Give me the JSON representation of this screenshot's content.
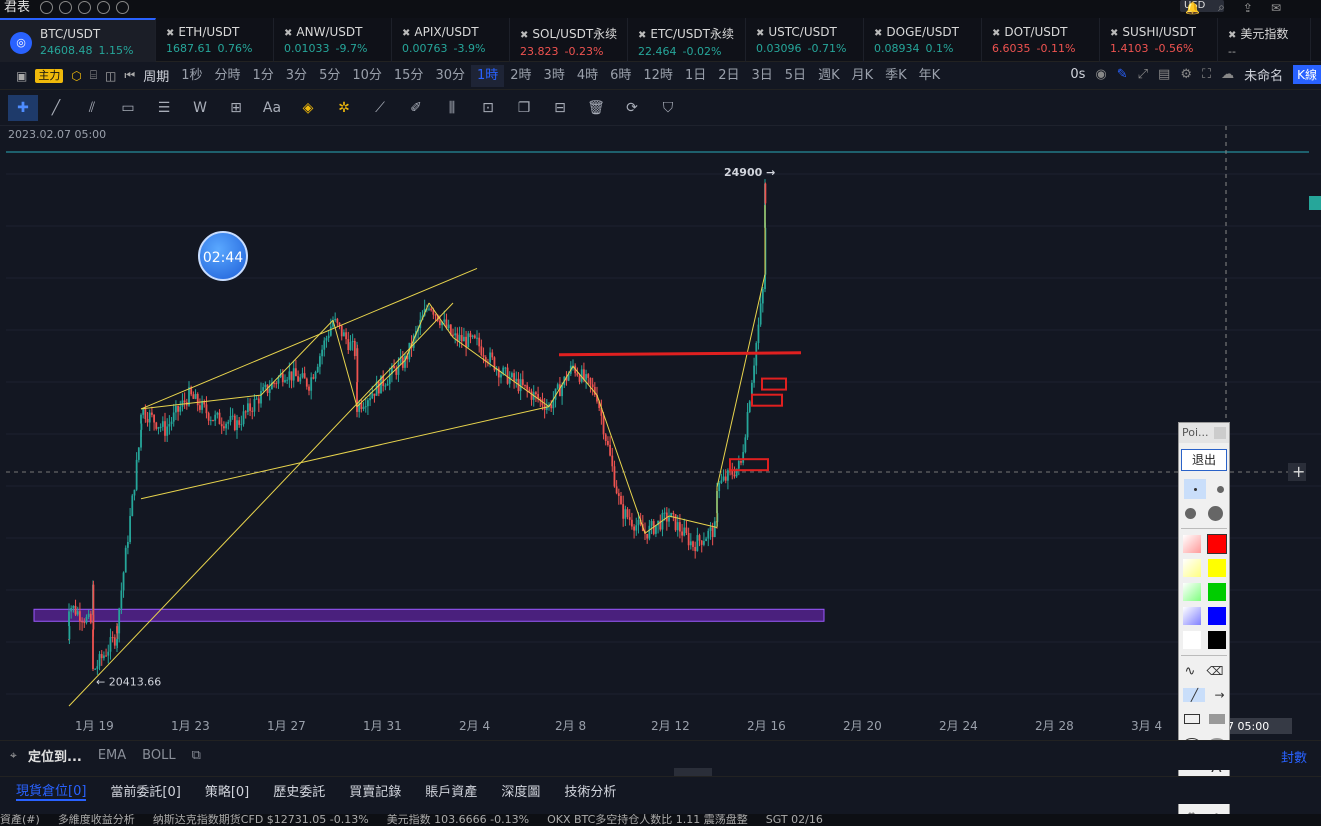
{
  "app": {
    "brand": "君表",
    "currency": "USD"
  },
  "tickers": [
    {
      "name": "BTC/USDT",
      "price": "24608.48",
      "change": "1.15%",
      "dir": "up",
      "active": true
    },
    {
      "name": "ETH/USDT",
      "price": "1687.61",
      "change": "0.76%",
      "dir": "up"
    },
    {
      "name": "ANW/USDT",
      "price": "0.01033",
      "change": "-9.7%",
      "dir": "up"
    },
    {
      "name": "APIX/USDT",
      "price": "0.00763",
      "change": "-3.9%",
      "dir": "up"
    },
    {
      "name": "SOL/USDT永续",
      "price": "23.823",
      "change": "-0.23%",
      "dir": "dn"
    },
    {
      "name": "ETC/USDT永续",
      "price": "22.464",
      "change": "-0.02%",
      "dir": "up"
    },
    {
      "name": "USTC/USDT",
      "price": "0.03096",
      "change": "-0.71%",
      "dir": "up"
    },
    {
      "name": "DOGE/USDT",
      "price": "0.08934",
      "change": "0.1%",
      "dir": "up"
    },
    {
      "name": "DOT/USDT",
      "price": "6.6035",
      "change": "-0.11%",
      "dir": "dn"
    },
    {
      "name": "SUSHI/USDT",
      "price": "1.4103",
      "change": "-0.56%",
      "dir": "dn"
    },
    {
      "name": "美元指数",
      "price": "--",
      "change": "",
      "dir": "up"
    }
  ],
  "timeframe": {
    "main_badge": "主力",
    "period_label": "周期",
    "items": [
      "1秒",
      "分時",
      "1分",
      "3分",
      "5分",
      "10分",
      "15分",
      "30分",
      "1時",
      "2時",
      "3時",
      "4時",
      "6時",
      "12時",
      "1日",
      "2日",
      "3日",
      "5日",
      "週K",
      "月K",
      "季K",
      "年K"
    ],
    "selected": "1時",
    "countdown": "0s",
    "layout_name": "未命名",
    "k_button": "K線"
  },
  "toolbar": {
    "text_tool": "Aa"
  },
  "chart_data": {
    "type": "candlestick",
    "symbol": "BTC/USDT",
    "interval": "1時",
    "timestamp": "2023.02.07 05:00",
    "xticks": [
      "1月 19",
      "1月 23",
      "1月 27",
      "1月 31",
      "2月 4",
      "2月 8",
      "2月 12",
      "2月 16",
      "2月 20",
      "2月 24",
      "2月 28",
      "3月 4"
    ],
    "crosshair_time": "07 05:00",
    "high_label": "24900 →",
    "low_label": "← 20413.66",
    "high": 24900,
    "low": 20413.66,
    "ylim": [
      20200,
      25150
    ],
    "path_points": [
      [
        "1月 18",
        20780
      ],
      [
        "1月 18",
        21080
      ],
      [
        "1月 19",
        20900
      ],
      [
        "1月 19",
        21200
      ],
      [
        "1月 19",
        20500
      ],
      [
        "1月 20",
        20820
      ],
      [
        "1月 20",
        20900
      ],
      [
        "1月 21",
        22600
      ],
      [
        "1月 21",
        22780
      ],
      [
        "1月 22",
        22600
      ],
      [
        "1月 23",
        22900
      ],
      [
        "1月 24",
        22700
      ],
      [
        "1月 25",
        22650
      ],
      [
        "1月 26",
        22900
      ],
      [
        "1月 27",
        23100
      ],
      [
        "1月 28",
        23000
      ],
      [
        "1月 29",
        23550
      ],
      [
        "1月 30",
        23250
      ],
      [
        "1月 30",
        22800
      ],
      [
        "1月 31",
        23000
      ],
      [
        "2月 1",
        23200
      ],
      [
        "2月 2",
        23700
      ],
      [
        "2月 3",
        23400
      ],
      [
        "2月 4",
        23350
      ],
      [
        "2月 5",
        23100
      ],
      [
        "2月 6",
        22950
      ],
      [
        "2月 7",
        22800
      ],
      [
        "2月 8",
        23150
      ],
      [
        "2月 9",
        22900
      ],
      [
        "2月 10",
        21900
      ],
      [
        "2月 11",
        21700
      ],
      [
        "2月 12",
        21850
      ],
      [
        "2月 13",
        21600
      ],
      [
        "2月 14",
        21750
      ],
      [
        "2月 14",
        22100
      ],
      [
        "2月 15",
        22300
      ],
      [
        "2月 16",
        23950
      ],
      [
        "2月 16",
        24700
      ],
      [
        "2月 16",
        24550
      ]
    ],
    "annotations": {
      "resistance_level": 23250,
      "support_zone": [
        20980,
        21040
      ],
      "boxes": [
        23000,
        22860,
        22300
      ]
    }
  },
  "timer_label": "02:44",
  "palette": {
    "title": "Poi...",
    "exit": "退出",
    "colors": [
      "#ff9a9a",
      "#ff0000",
      "#ffff80",
      "#ffff00",
      "#80ff80",
      "#00cc00",
      "#8080ff",
      "#0000ff",
      "#ffffff",
      "#000000"
    ]
  },
  "bottombar": {
    "locate": "定位到...",
    "ema": "EMA",
    "boll": "BOLL",
    "seal": "封數"
  },
  "tabs": [
    "現貨倉位[0]",
    "當前委託[0]",
    "策略[0]",
    "歷史委託",
    "買賣記錄",
    "賬戶資產",
    "深度圖",
    "技術分析"
  ],
  "ticker_strip": [
    "資產(#)",
    "多維度收益分析",
    "纳斯达克指数期货CFD $12731.05 -0.13%",
    "美元指数 103.6666 -0.13%",
    "OKX BTC多空持仓人数比 1.11 震荡盘整",
    "SGT 02/16"
  ]
}
